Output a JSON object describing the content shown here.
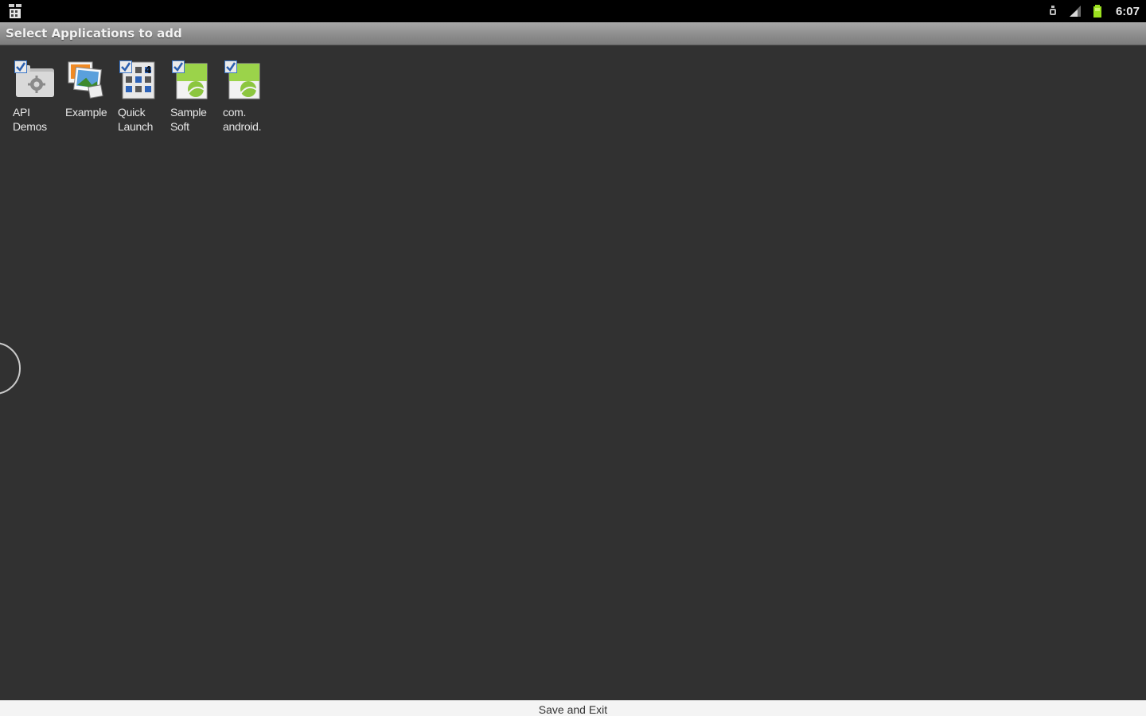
{
  "status_bar": {
    "left_icon": "notification-app-icon",
    "icons": [
      "usb-debug-icon",
      "signal-icon",
      "battery-icon"
    ],
    "time": "6:07"
  },
  "title_bar": {
    "title": "Select Applications to add"
  },
  "apps": [
    {
      "label": "API\nDemos",
      "icon": "api-demos-folder-gear-icon",
      "checked": true
    },
    {
      "label": "Example",
      "icon": "example-gallery-icon",
      "checked": false
    },
    {
      "label": "Quick\nLaunch",
      "icon": "quick-launch-icon",
      "checked": true
    },
    {
      "label": "Sample\nSoft",
      "icon": "android-default-app-icon",
      "checked": true
    },
    {
      "label": "com.\nandroid.",
      "icon": "android-default-app-icon",
      "checked": true
    }
  ],
  "bottom": {
    "save_exit_label": "Save and Exit"
  },
  "colors": {
    "background": "#313131",
    "status_bar": "#000000",
    "title_bar": "#8e8e8e",
    "checkbox_blue": "#3a76c8"
  }
}
